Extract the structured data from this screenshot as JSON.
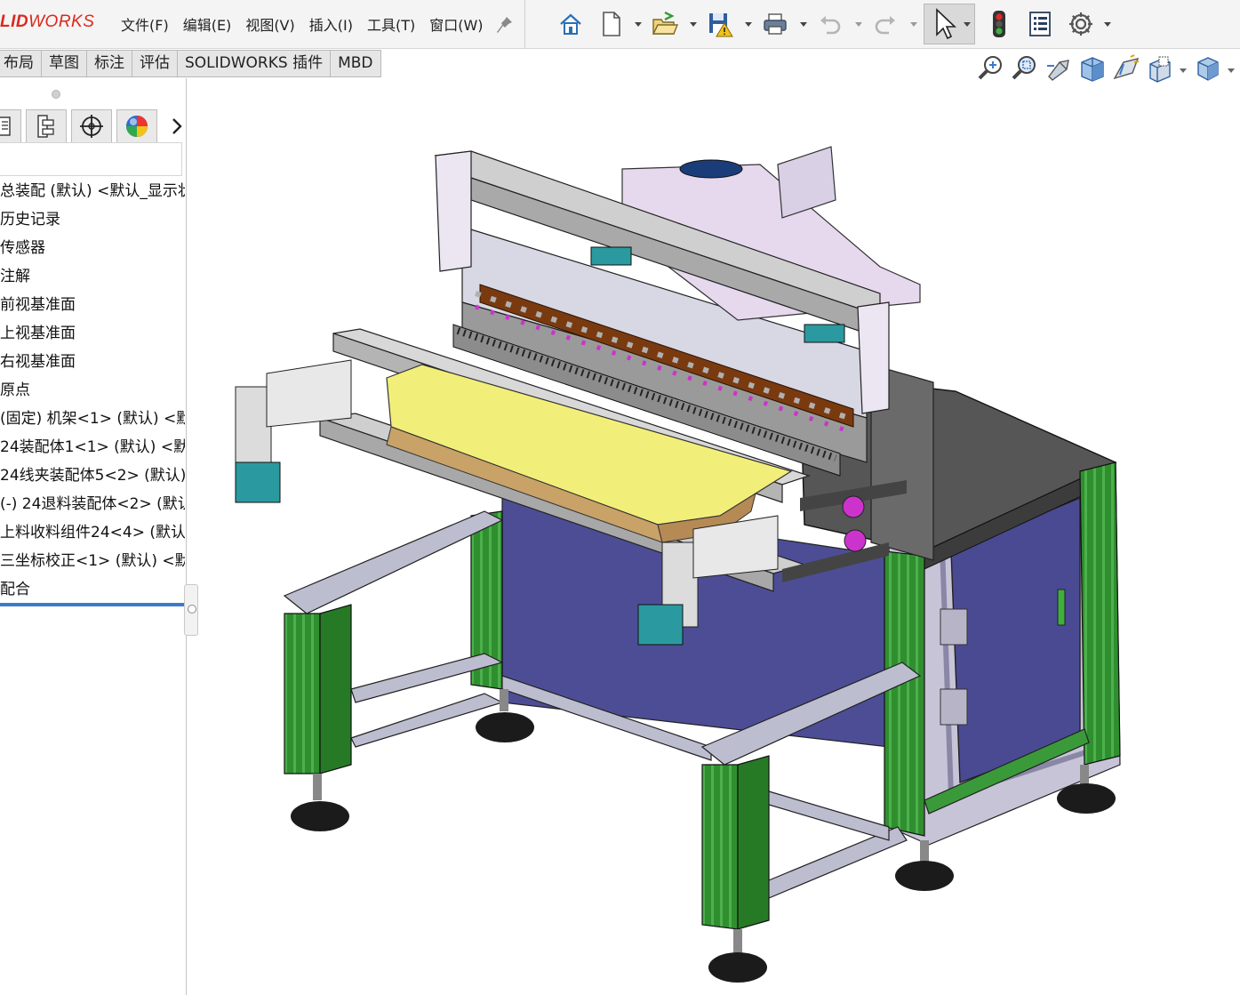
{
  "app": {
    "brand_prefix": "LID",
    "brand_suffix": "WORKS",
    "brand_color": "#da291c"
  },
  "menu": {
    "items": [
      "文件(F)",
      "编辑(E)",
      "视图(V)",
      "插入(I)",
      "工具(T)",
      "窗口(W)"
    ]
  },
  "quick_access": {
    "icons": [
      "home-icon",
      "new-document-icon",
      "open-icon",
      "save-warning-icon",
      "print-icon",
      "undo-icon",
      "redo-icon",
      "select-pointer-icon",
      "rebuild-traffic-light-icon",
      "file-properties-icon",
      "options-gear-icon"
    ]
  },
  "tabs": [
    "布局",
    "草图",
    "标注",
    "评估",
    "SOLIDWORKS 插件",
    "MBD"
  ],
  "view_toolbar": {
    "icons": [
      "zoom-to-fit-icon",
      "zoom-area-icon",
      "previous-view-icon",
      "section-view-icon",
      "dynamic-annotation-icon",
      "view-orientation-icon",
      "display-style-icon"
    ]
  },
  "feature_tree": {
    "items": [
      "总装配 (默认) <默认_显示状",
      "历史记录",
      "传感器",
      "注解",
      "前视基准面",
      "上视基准面",
      "右视基准面",
      "原点",
      "(固定) 机架<1> (默认) <默",
      "24装配体1<1> (默认) <默",
      "24线夹装配体5<2> (默认)",
      "(-) 24退料装配体<2> (默认",
      "上料收料组件24<4> (默认",
      "三坐标校正<1> (默认) <默",
      "配合"
    ]
  },
  "colors": {
    "frame_green": "#2e8b2e",
    "cabinet_blue": "#4a4a9a",
    "top_plate": "#555555",
    "tray_yellow": "#f2ee7a",
    "accent_teal": "#2a9aa0",
    "accent_magenta": "#cc33cc",
    "rollback_bar": "#3a7ccc"
  }
}
